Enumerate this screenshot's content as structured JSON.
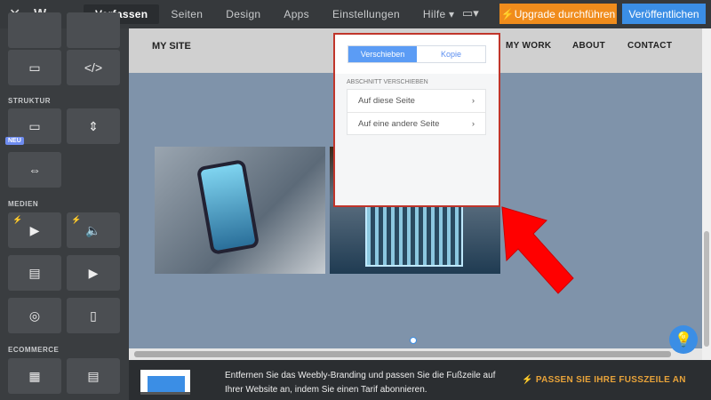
{
  "topbar": {
    "logo": "W",
    "nav": [
      "Verfassen",
      "Seiten",
      "Design",
      "Apps",
      "Einstellungen",
      "Hilfe ▾"
    ],
    "device": "▭▾",
    "upgrade": "Upgrade durchführen",
    "publish": "Veröffentlichen"
  },
  "sidebar": {
    "struktur": "STRUKTUR",
    "neu": "NEU",
    "medien": "MEDIEN",
    "ecommerce": "ECOMMERCE"
  },
  "site": {
    "title": "MY SITE",
    "menu": [
      "MY WORK",
      "ABOUT",
      "CONTACT"
    ]
  },
  "popup": {
    "tabs": [
      "Verschieben",
      "Kopie"
    ],
    "label": "ABSCHNITT VERSCHIEBEN",
    "items": [
      "Auf diese Seite",
      "Auf eine andere Seite"
    ]
  },
  "footer": {
    "text": "Entfernen Sie das Weebly-Branding und passen Sie die Fußzeile auf Ihrer Website an, indem Sie einen Tarif abonnieren.",
    "cta": "PASSEN SIE IHRE FUSSZEILE AN"
  },
  "colors": {
    "accent": "#3b8ee5",
    "upgrade": "#f08c1c",
    "highlight": "#c0352b"
  }
}
